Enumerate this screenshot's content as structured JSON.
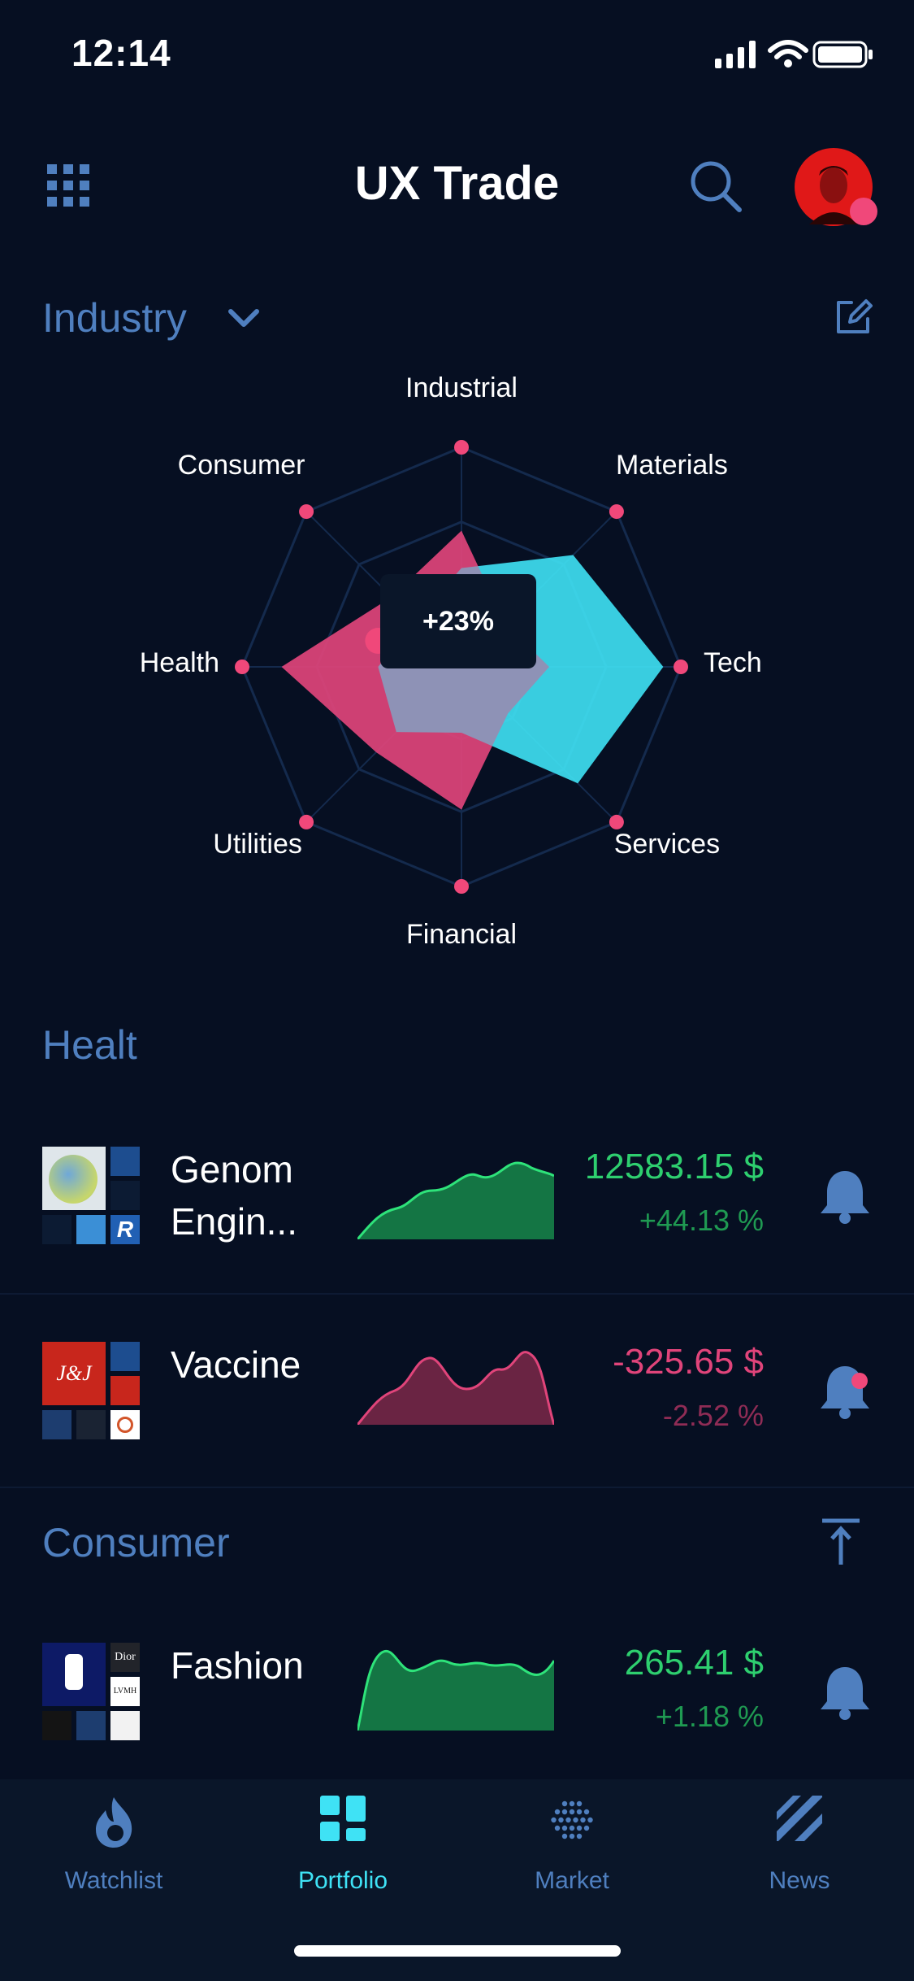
{
  "status_bar": {
    "time": "12:14"
  },
  "header": {
    "title": "UX Trade",
    "menu_icon": "grid-icon",
    "search_icon": "search-icon",
    "avatar_icon": "avatar"
  },
  "industry": {
    "selector_label": "Industry",
    "edit_icon": "edit-icon"
  },
  "chart_data": {
    "type": "radar",
    "axes": [
      "Industrial",
      "Materials",
      "Tech",
      "Services",
      "Financial",
      "Utilities",
      "Health",
      "Consumer"
    ],
    "tooltip": "+23%",
    "series": [
      {
        "color": "#e0447a",
        "values": [
          0.62,
          0.28,
          0.4,
          0.3,
          0.65,
          0.55,
          0.82,
          0.45
        ]
      },
      {
        "color": "#3fe2f5",
        "values": [
          0.45,
          0.72,
          0.92,
          0.75,
          0.3,
          0.42,
          0.38,
          0.3
        ]
      }
    ]
  },
  "health_section": {
    "title": "Healt",
    "items": [
      {
        "name_line1": "Genom",
        "name_line2": "Engin...",
        "price": "12583.15 $",
        "change": "+44.13 %",
        "trend": "up"
      },
      {
        "name_line1": "Vaccine",
        "name_line2": "",
        "price": "-325.65 $",
        "change": "-2.52 %",
        "trend": "down"
      }
    ]
  },
  "consumer_section": {
    "title": "Consumer",
    "items": [
      {
        "name_line1": "Fashion",
        "name_line2": "",
        "price": "265.41 $",
        "change": "+1.18 %",
        "trend": "up"
      }
    ]
  },
  "tabs": [
    {
      "label": "Watchlist",
      "icon": "flame-icon",
      "active": false
    },
    {
      "label": "Portfolio",
      "icon": "portfolio-icon",
      "active": true
    },
    {
      "label": "Market",
      "icon": "market-dots-icon",
      "active": false
    },
    {
      "label": "News",
      "icon": "news-stripes-icon",
      "active": false
    }
  ],
  "colors": {
    "background": "#060f22",
    "accent_blue": "#4f7fbf",
    "cyan": "#3fe2f5",
    "pink": "#e0447a",
    "green": "#2ecf6f",
    "red": "#e0447a"
  }
}
